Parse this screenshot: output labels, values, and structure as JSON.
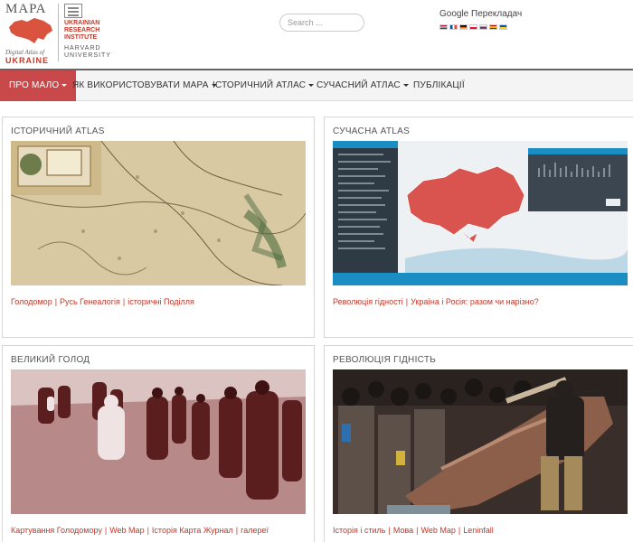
{
  "logo": {
    "mapa": "МАРА",
    "sub": "Digital Atlas of",
    "ukraine": "UKRAINE",
    "institute": "UKRAINIAN RESEARCH INSTITUTE",
    "harvard": "HARVARD UNIVERSITY"
  },
  "search": {
    "placeholder": "Search ..."
  },
  "translate": {
    "title": "Google Перекладач",
    "flags": [
      "us",
      "fr",
      "de",
      "pl",
      "ru",
      "es",
      "ua"
    ]
  },
  "nav": [
    {
      "label": "ПРО МАЛО",
      "dropdown": true,
      "active": true
    },
    {
      "label": "ЯК ВИКОРИСТОВУВАТИ МАРА",
      "dropdown": true,
      "active": false
    },
    {
      "label": "ІСТОРИЧНИЙ АТЛАС",
      "dropdown": true,
      "active": false
    },
    {
      "label": "СУЧАСНИЙ АТЛАС",
      "dropdown": true,
      "active": false
    },
    {
      "label": "ПУБЛІКАЦІЇ",
      "dropdown": false,
      "active": false
    }
  ],
  "cards": [
    {
      "title": "ІСТОРИЧНИЙ ATLAS",
      "links": [
        "Голодомор",
        "Русь Генеалогія",
        "історичні Поділля"
      ]
    },
    {
      "title": "СУЧАСНА ATLAS",
      "links": [
        "Революція гідності",
        "Україна і Росія: разом чи нарізно?"
      ]
    },
    {
      "title": "ВЕЛИКИЙ ГОЛОД",
      "links": [
        "Картування Голодомору",
        "Web Map",
        "Історія Карта Журнал",
        "галереї"
      ]
    },
    {
      "title": "РЕВОЛЮЦІЯ ГІДНІСТЬ",
      "links": [
        "Історія і стиль",
        "Мова",
        "Web Map",
        "Leninfall"
      ]
    }
  ],
  "colors": {
    "accent": "#c9484a",
    "link": "#c0392b"
  }
}
